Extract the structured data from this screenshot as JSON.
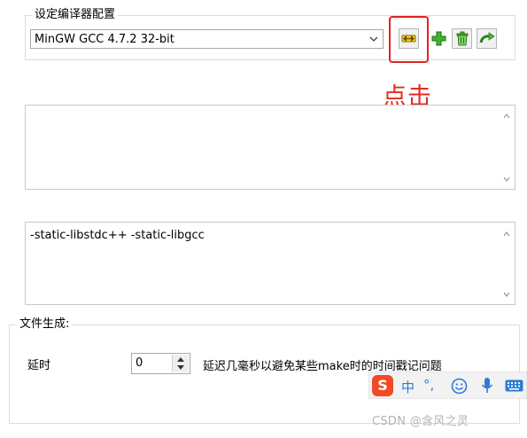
{
  "compiler_group": {
    "title": "设定编译器配置",
    "selected_compiler": "MinGW GCC 4.7.2 32-bit",
    "toolbar": [
      {
        "name": "rename-config",
        "icon": "rename-arrows-icon"
      },
      {
        "name": "add-config",
        "icon": "green-plus-icon"
      },
      {
        "name": "delete-config",
        "icon": "trash-icon"
      },
      {
        "name": "import-config",
        "icon": "curved-arrow-icon"
      }
    ]
  },
  "annotation": {
    "text": "点击",
    "color": "#e62a1f"
  },
  "compiler_options": {
    "value": ""
  },
  "linker_options": {
    "value": "-static-libstdc++ -static-libgcc"
  },
  "file_generation": {
    "title": "文件生成:",
    "delay_label": "延时",
    "delay_value": "0",
    "delay_description": "延迟几毫秒以避免某些make时的时间戳记问题"
  },
  "ime_toolbar": {
    "logo": "S",
    "language": "中",
    "punctuation": "°,"
  },
  "watermark": "CSDN @含风之灵"
}
